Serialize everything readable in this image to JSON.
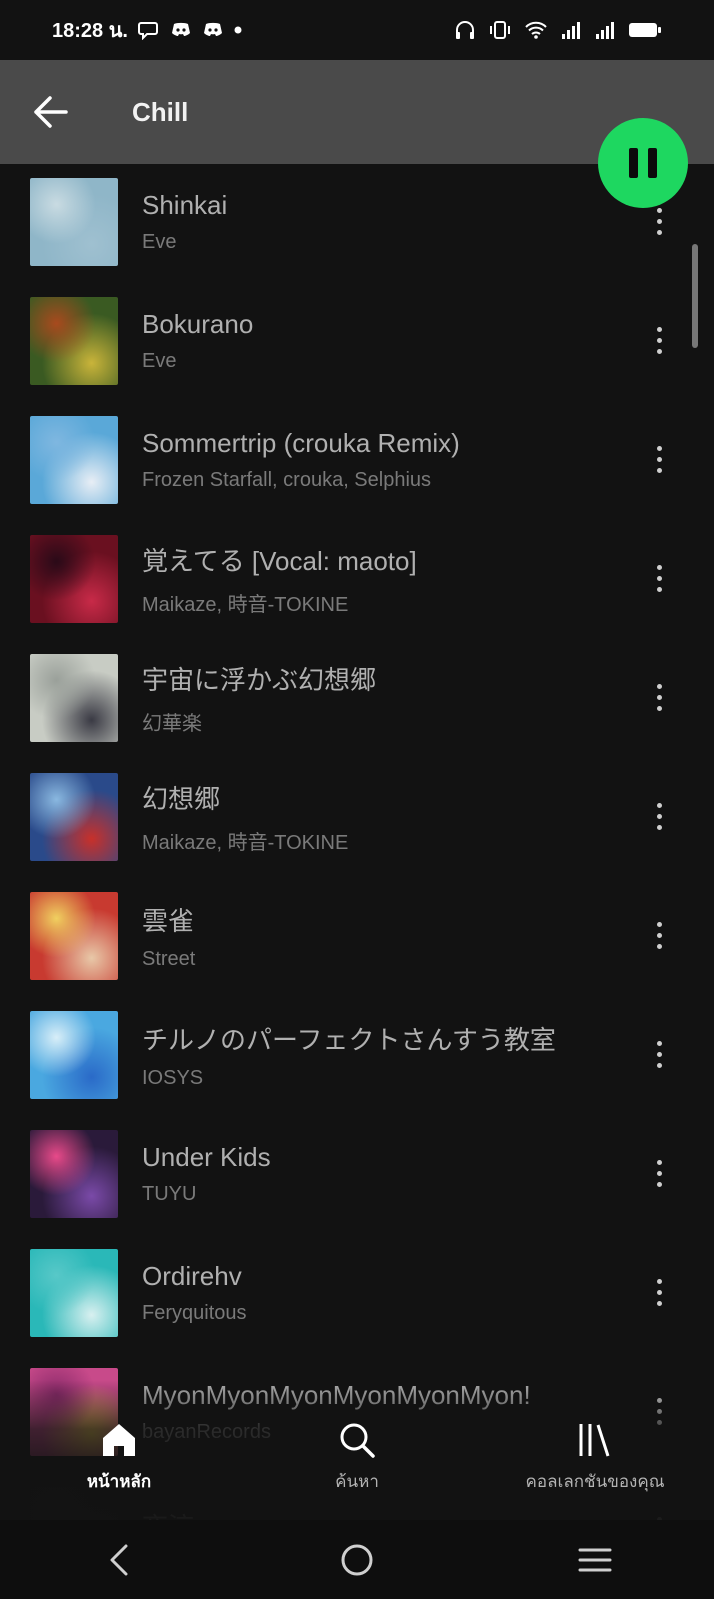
{
  "status_bar": {
    "time": "18:28 น.",
    "notification_icons": [
      "chat-bubble-icon",
      "discord-icon",
      "discord-icon",
      "dot-icon"
    ],
    "system_icons": [
      "headphones-icon",
      "vibrate-icon",
      "wifi-icon",
      "signal-icon",
      "signal-icon",
      "battery-icon"
    ]
  },
  "header": {
    "title": "Chill"
  },
  "playlist": {
    "tracks": [
      {
        "title": "Shinkai",
        "artist": "Eve",
        "cover_colors": [
          "#8fb6c8",
          "#9fc0d0",
          "#c9dbe2"
        ]
      },
      {
        "title": "Bokurano",
        "artist": "Eve",
        "cover_colors": [
          "#3a5a22",
          "#c9b43a",
          "#a84a1e"
        ]
      },
      {
        "title": "Sommertrip (crouka Remix)",
        "artist": "Frozen Starfall, crouka, Selphius",
        "cover_colors": [
          "#5aa8d8",
          "#e8eef5",
          "#7fb7e0"
        ]
      },
      {
        "title": "覚えてる [Vocal: maoto]",
        "artist": "Maikaze, 時音-TOKINE",
        "cover_colors": [
          "#6a1020",
          "#c82a48",
          "#2a0a18"
        ]
      },
      {
        "title": "宇宙に浮かぶ幻想郷",
        "artist": "幻華楽",
        "cover_colors": [
          "#c8ccc4",
          "#3a3a44",
          "#9aa09a"
        ]
      },
      {
        "title": "幻想郷",
        "artist": "Maikaze, 時音-TOKINE",
        "cover_colors": [
          "#2a4a8a",
          "#c8302a",
          "#8ab8e0"
        ]
      },
      {
        "title": "雲雀",
        "artist": "Street",
        "cover_colors": [
          "#c83a30",
          "#e8c8a8",
          "#f0d060"
        ]
      },
      {
        "title": "チルノのパーフェクトさんすう教室",
        "artist": "IOSYS",
        "cover_colors": [
          "#4aa8e0",
          "#2a6ac8",
          "#d8eef8"
        ]
      },
      {
        "title": "Under Kids",
        "artist": "TUYU",
        "cover_colors": [
          "#2a1a3a",
          "#7a4aa8",
          "#e84a8a"
        ]
      },
      {
        "title": "Ordirehv",
        "artist": "Feryquitous",
        "cover_colors": [
          "#2ab8b8",
          "#d8f0f0",
          "#58c8c8"
        ]
      },
      {
        "title": "MyonMyonMyonMyonMyonMyon!",
        "artist": "bayanRecords",
        "cover_colors": [
          "#c84a8a",
          "#f0c850",
          "#8a2a6a"
        ]
      },
      {
        "title": "夜涼",
        "artist": "",
        "cover_colors": [
          "#1a1a1a",
          "#3a3a3a",
          "#2a2a2a"
        ]
      }
    ]
  },
  "bottom_nav": {
    "items": [
      {
        "label": "หน้าหลัก",
        "icon": "home-icon",
        "active": true
      },
      {
        "label": "ค้นหา",
        "icon": "search-icon",
        "active": false
      },
      {
        "label": "คอลเลกชันของคุณ",
        "icon": "library-icon",
        "active": false
      }
    ]
  },
  "colors": {
    "background": "#121212",
    "header": "#4a4a4a",
    "accent": "#1ed760",
    "title_text": "#b0b0b0",
    "subtitle_text": "#7a7a7a"
  }
}
